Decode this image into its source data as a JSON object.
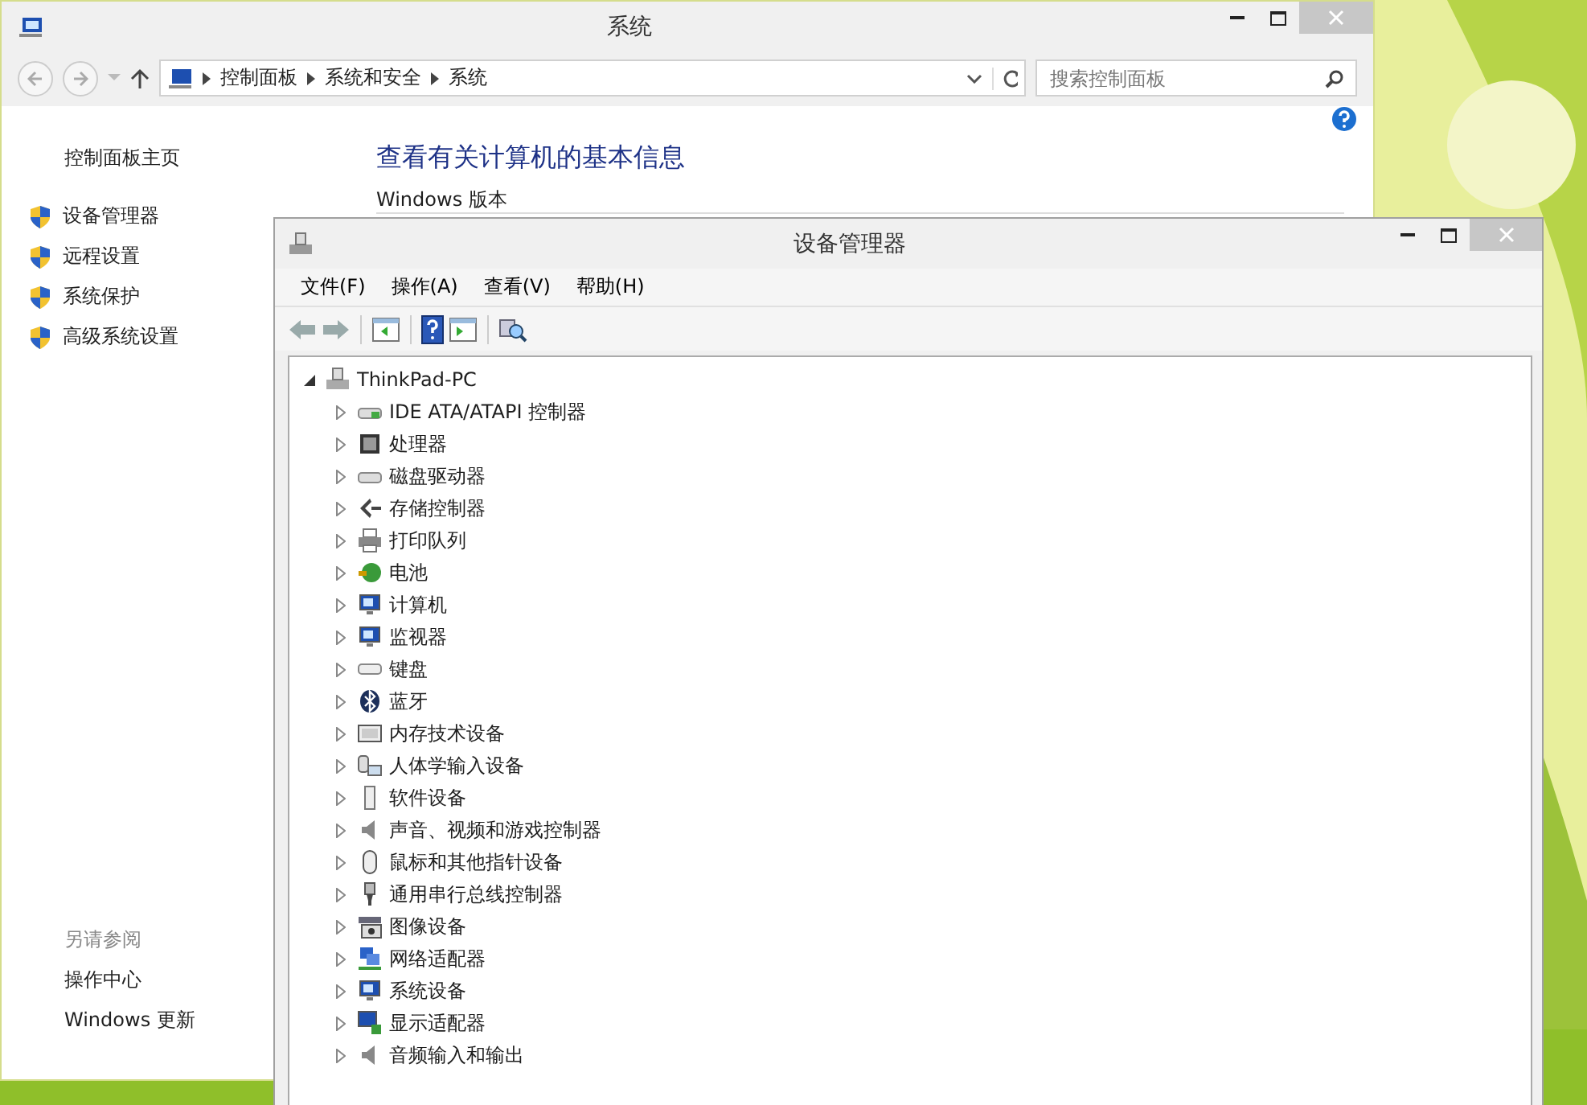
{
  "system_window": {
    "title": "系统",
    "address": {
      "breadcrumbs": [
        "控制面板",
        "系统和安全",
        "系统"
      ]
    },
    "search": {
      "placeholder": "搜索控制面板"
    },
    "sidebar": {
      "home": "控制面板主页",
      "links": [
        "设备管理器",
        "远程设置",
        "系统保护",
        "高级系统设置"
      ],
      "see_also_heading": "另请参阅",
      "see_also": [
        "操作中心",
        "Windows 更新"
      ]
    },
    "main": {
      "heading": "查看有关计算机的基本信息",
      "section": "Windows 版本"
    }
  },
  "device_manager": {
    "title": "设备管理器",
    "menu": [
      "文件(F)",
      "操作(A)",
      "查看(V)",
      "帮助(H)"
    ],
    "tree": {
      "label": "ThinkPad-PC",
      "expanded": true,
      "children": [
        {
          "label": "IDE ATA/ATAPI 控制器",
          "expanded": false
        },
        {
          "label": "处理器",
          "expanded": false
        },
        {
          "label": "磁盘驱动器",
          "expanded": false
        },
        {
          "label": "存储控制器",
          "expanded": false
        },
        {
          "label": "打印队列",
          "expanded": false
        },
        {
          "label": "电池",
          "expanded": false
        },
        {
          "label": "计算机",
          "expanded": false
        },
        {
          "label": "监视器",
          "expanded": false
        },
        {
          "label": "键盘",
          "expanded": false
        },
        {
          "label": "蓝牙",
          "expanded": false
        },
        {
          "label": "内存技术设备",
          "expanded": false
        },
        {
          "label": "人体学输入设备",
          "expanded": false
        },
        {
          "label": "软件设备",
          "expanded": false
        },
        {
          "label": "声音、视频和游戏控制器",
          "expanded": false
        },
        {
          "label": "鼠标和其他指针设备",
          "expanded": false
        },
        {
          "label": "通用串行总线控制器",
          "expanded": false
        },
        {
          "label": "图像设备",
          "expanded": false
        },
        {
          "label": "网络适配器",
          "expanded": false
        },
        {
          "label": "系统设备",
          "expanded": false
        },
        {
          "label": "显示适配器",
          "expanded": false
        },
        {
          "label": "音频输入和输出",
          "expanded": false
        }
      ]
    }
  }
}
